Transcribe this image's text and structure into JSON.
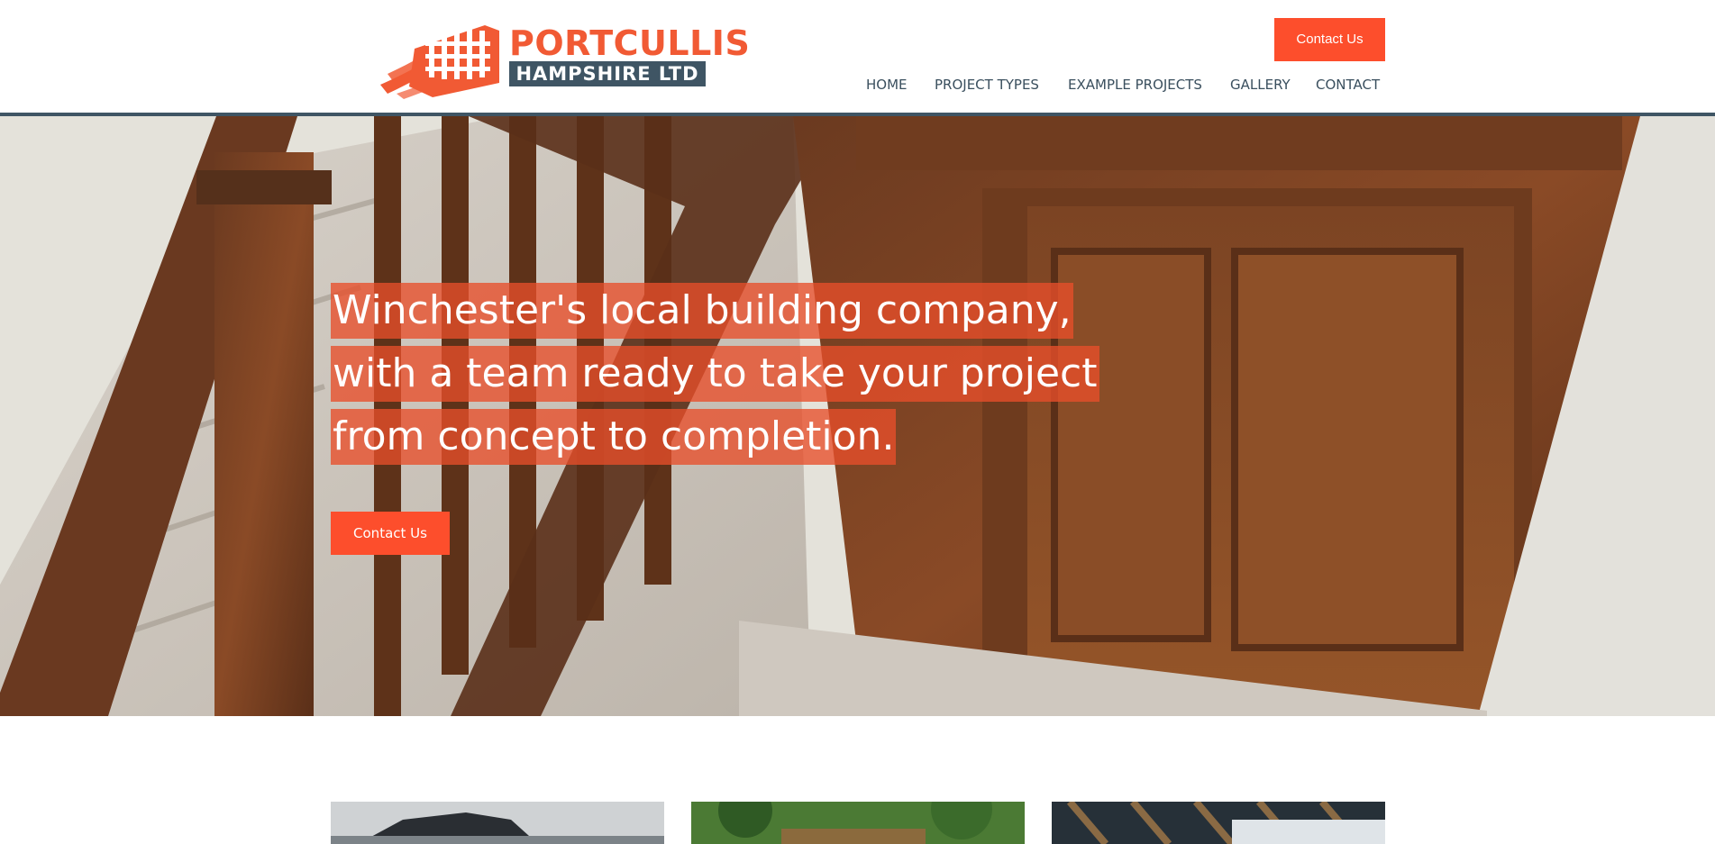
{
  "header": {
    "logo": {
      "line1": "PORTCULLIS",
      "line2": "HAMPSHIRE LTD"
    },
    "contact_button": "Contact Us",
    "nav": [
      {
        "label": "HOME"
      },
      {
        "label": "PROJECT TYPES"
      },
      {
        "label": "EXAMPLE PROJECTS"
      },
      {
        "label": "GALLERY"
      },
      {
        "label": "CONTACT"
      }
    ]
  },
  "hero": {
    "headline_lines": [
      "Winchester's local building company,",
      "with a team ready to take your project",
      "from concept to completion."
    ],
    "contact_button": "Contact Us"
  },
  "colors": {
    "accent": "#fd4e2c",
    "brand_dark": "#3f5564",
    "nav_text": "#3a4f5e"
  }
}
